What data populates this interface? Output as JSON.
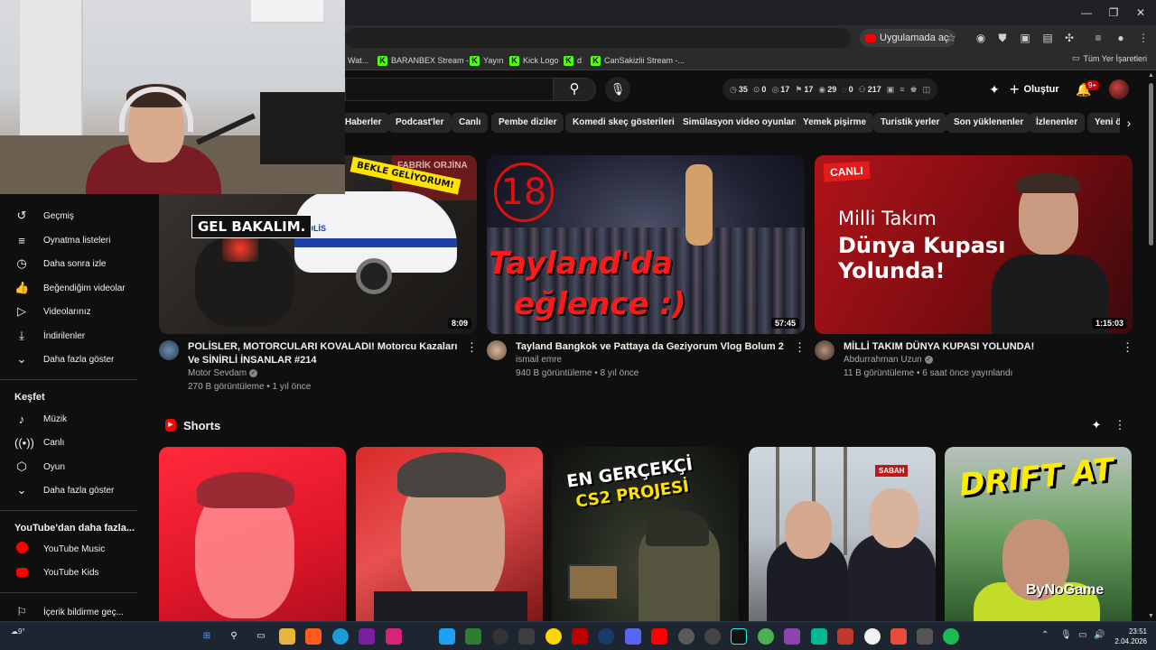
{
  "browser": {
    "open_in_app": "Uygulamada aç",
    "bookmarks": [
      {
        "label": "Wat...",
        "kick": false
      },
      {
        "label": "BARANBEX Stream -...",
        "kick": true
      },
      {
        "label": "Yayın",
        "kick": true
      },
      {
        "label": "Kick Logo",
        "kick": true
      },
      {
        "label": "d",
        "kick": true
      },
      {
        "label": "CanSakizlii Stream -...",
        "kick": true
      }
    ],
    "all_bookmarks": "Tüm Yer İşaretleri"
  },
  "header": {
    "stats": [
      {
        "icon": "clock-icon",
        "value": "35"
      },
      {
        "icon": "eye-icon",
        "value": "0"
      },
      {
        "icon": "eye-icon",
        "value": "17"
      },
      {
        "icon": "flag-icon",
        "value": "17"
      },
      {
        "icon": "eye-icon",
        "value": "29"
      },
      {
        "icon": "chat-icon",
        "value": "0"
      },
      {
        "icon": "person-icon",
        "value": "217"
      }
    ],
    "create_label": "Oluştur",
    "notif_count": "9+"
  },
  "chips": [
    "Haberler",
    "Podcast'ler",
    "Canlı",
    "Pembe diziler",
    "Komedi skeç gösterileri",
    "Simülasyon video oyunları",
    "Yemek pişirme",
    "Turistik yerler",
    "Son yüklenenler",
    "İzlenenler",
    "Yeni ör"
  ],
  "sidebar": {
    "items": [
      {
        "icon": "history-icon",
        "label": "Geçmiş"
      },
      {
        "icon": "playlist-icon",
        "label": "Oynatma listeleri"
      },
      {
        "icon": "watch-later-icon",
        "label": "Daha sonra izle"
      },
      {
        "icon": "like-icon",
        "label": "Beğendiğim videolar"
      },
      {
        "icon": "my-videos-icon",
        "label": "Videolarınız"
      },
      {
        "icon": "download-icon",
        "label": "İndirilenler"
      },
      {
        "icon": "chevron-down-icon",
        "label": "Daha fazla göster"
      }
    ],
    "explore_title": "Keşfet",
    "explore": [
      {
        "icon": "music-icon",
        "label": "Müzik"
      },
      {
        "icon": "live-icon",
        "label": "Canlı"
      },
      {
        "icon": "gaming-icon",
        "label": "Oyun"
      },
      {
        "icon": "chevron-down-icon",
        "label": "Daha fazla göster"
      }
    ],
    "more_title": "YouTube'dan daha fazla...",
    "more": [
      {
        "icon": "youtube-music-icon",
        "label": "YouTube Music"
      },
      {
        "icon": "youtube-kids-icon",
        "label": "YouTube Kids"
      }
    ],
    "report": {
      "icon": "flag-icon",
      "label": "İçerik bildirme geç..."
    }
  },
  "videos": [
    {
      "title": "POLİSLER, MOTORCULARI KOVALADI! Motorcu Kazaları Ve SİNİRLİ İNSANLAR #214",
      "channel": "Motor Sevdam",
      "verified": true,
      "stats": "270 B görüntüleme • 1 yıl önce",
      "duration": "8:09",
      "thumb_text_a": "GEL BAKALIM.",
      "thumb_text_b": "BEKLE GELİYORUM!",
      "thumb_text_c": "POLİS",
      "thumb_text_d": "FABRİK ORJİNA SAS"
    },
    {
      "title": "Tayland Bangkok ve Pattaya da Geziyorum Vlog Bolum 2",
      "channel": "ismail emre",
      "verified": false,
      "stats": "940 B görüntüleme • 8 yıl önce",
      "duration": "57:45",
      "thumb_num": "18",
      "thumb_line1": "Tayland'da",
      "thumb_line2": "eğlence :)"
    },
    {
      "title": "MİLLİ TAKIM DÜNYA KUPASI YOLUNDA!",
      "channel": "Abdurrahman Uzun",
      "verified": true,
      "stats": "11 B görüntüleme • 6 saat önce yayınlandı",
      "duration": "1:15:03",
      "thumb_badge": "CANLI",
      "thumb_line1": "Milli Takım",
      "thumb_line2": "Dünya Kupası",
      "thumb_line3": "Yolunda!"
    }
  ],
  "shorts": {
    "title": "Shorts",
    "items": [
      {
        "text_a": "",
        "text_b": ""
      },
      {
        "text_a": "",
        "text_b": ""
      },
      {
        "text_a": "EN GERÇEKÇİ",
        "text_b": "CS2 PROJESİ"
      },
      {
        "text_a": "SABAH",
        "text_b": ""
      },
      {
        "text_a": "DRIFT AT",
        "text_b": "ByNoGame"
      }
    ]
  },
  "taskbar": {
    "weather": "9°",
    "time": "23:51",
    "date": "2.04.2026"
  }
}
